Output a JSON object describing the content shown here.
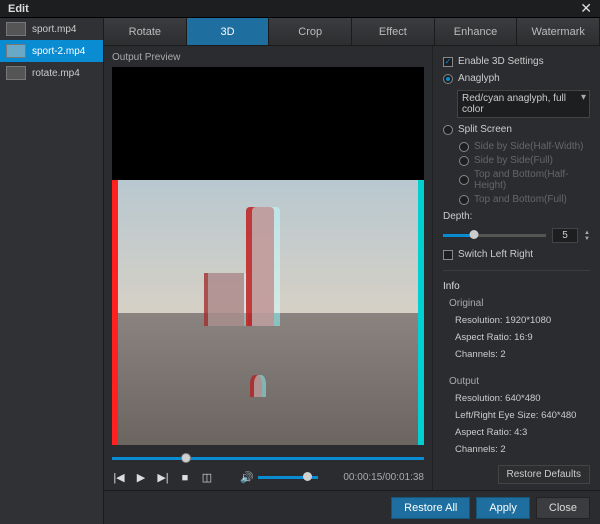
{
  "window": {
    "title": "Edit"
  },
  "sidebar": {
    "files": [
      {
        "name": "sport.mp4"
      },
      {
        "name": "sport-2.mp4"
      },
      {
        "name": "rotate.mp4"
      }
    ],
    "selectedIndex": 1
  },
  "tabs": {
    "items": [
      "Rotate",
      "3D",
      "Crop",
      "Effect",
      "Enhance",
      "Watermark"
    ],
    "activeIndex": 1
  },
  "preview": {
    "label": "Output Preview",
    "time": "00:00:15/00:01:38"
  },
  "settings": {
    "enable3d": {
      "label": "Enable 3D Settings",
      "checked": true
    },
    "anaglyph": {
      "label": "Anaglyph",
      "selected": true,
      "option": "Red/cyan anaglyph, full color"
    },
    "splitScreen": {
      "label": "Split Screen",
      "selected": false,
      "options": [
        "Side by Side(Half-Width)",
        "Side by Side(Full)",
        "Top and Bottom(Half-Height)",
        "Top and Bottom(Full)"
      ]
    },
    "depth": {
      "label": "Depth:",
      "value": "5"
    },
    "switchLR": {
      "label": "Switch Left Right",
      "checked": false
    },
    "restoreDefaults": "Restore Defaults"
  },
  "info": {
    "heading": "Info",
    "original": {
      "label": "Original",
      "resolution": "Resolution: 1920*1080",
      "aspect": "Aspect Ratio: 16:9",
      "channels": "Channels: 2"
    },
    "output": {
      "label": "Output",
      "resolution": "Resolution: 640*480",
      "eye": "Left/Right Eye Size: 640*480",
      "aspect": "Aspect Ratio: 4:3",
      "channels": "Channels: 2"
    }
  },
  "footer": {
    "restoreAll": "Restore All",
    "apply": "Apply",
    "close": "Close"
  }
}
